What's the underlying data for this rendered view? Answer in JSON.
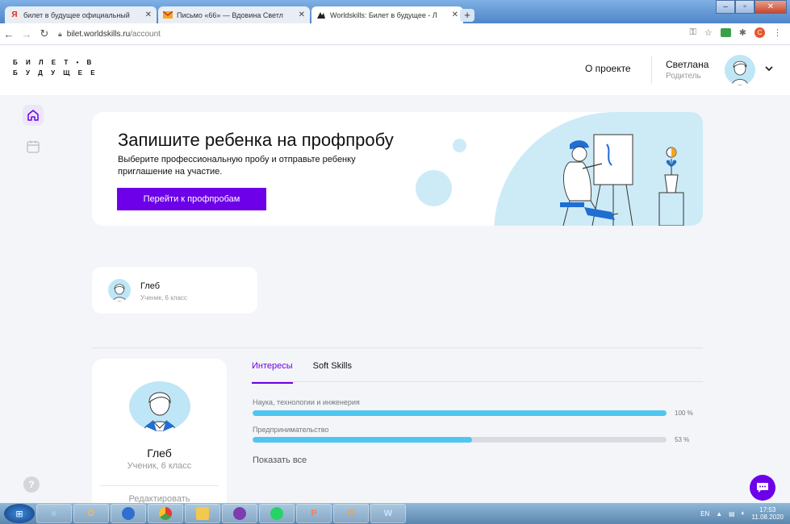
{
  "browser": {
    "tabs": [
      {
        "title": "билет в будущее официальный",
        "icon": "yandex-icon",
        "close": "✕"
      },
      {
        "title": "Письмо «66» — Вдовина Светл",
        "icon": "mail-icon",
        "close": "✕"
      },
      {
        "title": "Worldskills: Билет в будущее - Л",
        "icon": "worldskills-icon",
        "close": "✕"
      }
    ],
    "new_tab": "+",
    "url_domain": "bilet.worldskills.ru",
    "url_path": "/account",
    "ext_badge": "C"
  },
  "header": {
    "logo_line1": "Б И Л Е Т • В",
    "logo_line2": "Б У Д У Щ Е Е",
    "about_link": "О проекте",
    "user_name": "Светлана",
    "user_role": "Родитель"
  },
  "banner": {
    "title": "Запишите ребенка на профпробу",
    "text": "Выберите профессиональную пробу и отправьте ребенку приглашение на участие.",
    "button": "Перейти к профпробам"
  },
  "child_card": {
    "name": "Глеб",
    "grade": "Ученик, 6 класс"
  },
  "profile": {
    "name": "Глеб",
    "grade": "Ученик, 6 класс",
    "edit": "Редактировать"
  },
  "tabs": [
    {
      "label": "Интересы",
      "active": true
    },
    {
      "label": "Soft Skills",
      "active": false
    }
  ],
  "interests": [
    {
      "label": "Наука, технологии и инженерия",
      "value": 100,
      "percent_text": "100 %"
    },
    {
      "label": "Предпринимательство",
      "value": 53,
      "percent_text": "53 %"
    }
  ],
  "show_all": "Показать все",
  "taskbar": {
    "lang": "EN",
    "time": "17:53",
    "date": "11.08.2020"
  },
  "colors": {
    "accent": "#6d00e8",
    "progress": "#4fc6ef",
    "illustration_bg": "#cdebf7"
  }
}
